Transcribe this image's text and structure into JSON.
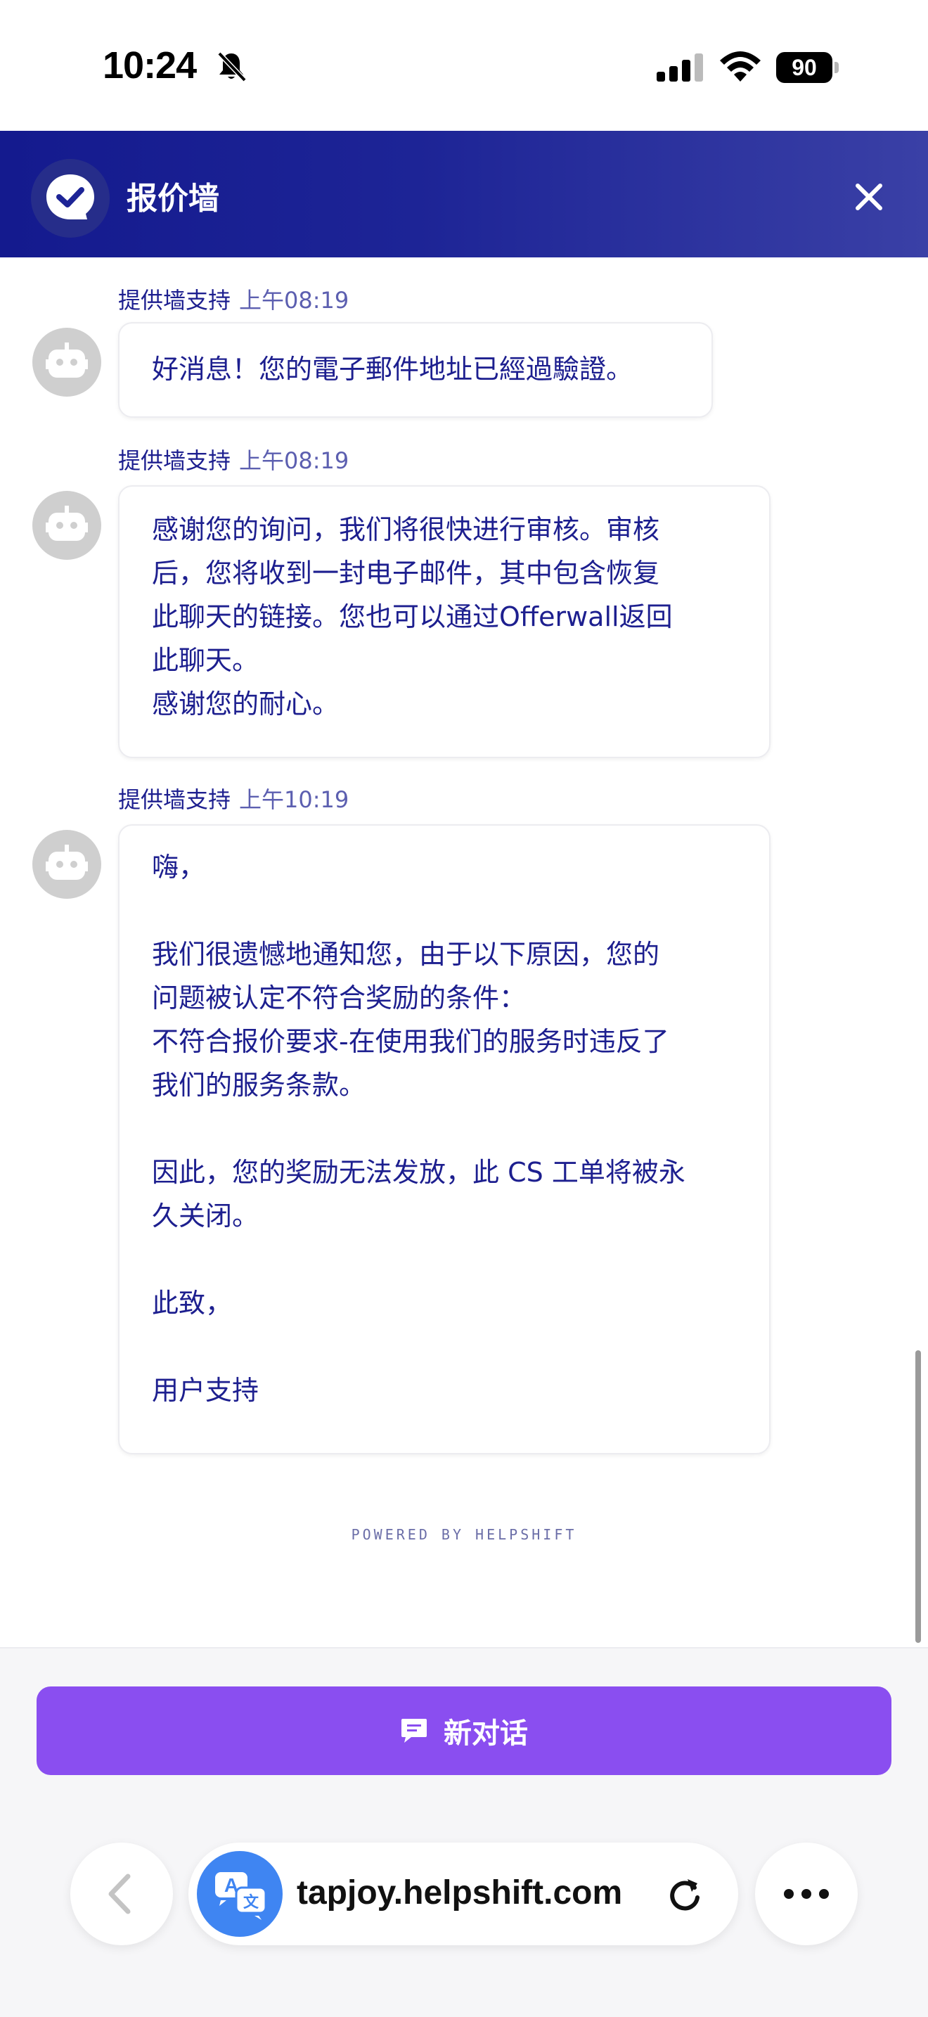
{
  "status_bar": {
    "time": "10:24",
    "battery": "90"
  },
  "header": {
    "title": "报价墙",
    "close_icon": "close-icon",
    "logo_icon": "chat-check-icon"
  },
  "messages": [
    {
      "sender": "提供墙支持",
      "time": "上午08:19",
      "text": "好消息！您的電子郵件地址已經過驗證。"
    },
    {
      "sender": "提供墙支持",
      "time": "上午08:19",
      "text": "感谢您的询问，我们将很快进行审核。审核\n后，您将收到一封电子邮件，其中包含恢复\n此聊天的链接。您也可以通过Offerwall返回\n此聊天。\n感谢您的耐心。"
    },
    {
      "sender": "提供墙支持",
      "time": "上午10:19",
      "text": "嗨，\n\n我们很遗憾地通知您，由于以下原因，您的\n问题被认定不符合奖励的条件：\n不符合报价要求-在使用我们的服务时违反了\n我们的服务条款。\n\n因此，您的奖励无法发放，此 CS 工单将被永\n久关闭。\n\n此致，\n\n用户支持"
    }
  ],
  "powered_by": "POWERED BY HELPSHIFT",
  "new_chat_label": "新对话",
  "browser": {
    "url": "tapjoy.helpshift.com"
  },
  "colors": {
    "header_start": "#141a8e",
    "header_end": "#3a40a6",
    "accent": "#8a4ef0",
    "text": "#1d1f8f"
  }
}
